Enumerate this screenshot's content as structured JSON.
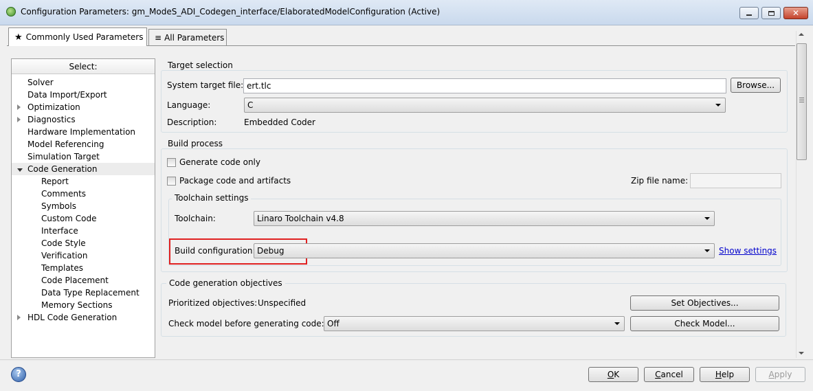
{
  "window": {
    "title": "Configuration Parameters: gm_ModeS_ADI_Codegen_interface/ElaboratedModelConfiguration (Active)",
    "close_glyph": "✕"
  },
  "tabs": [
    {
      "label": "Commonly Used Parameters",
      "icon": "star-icon",
      "glyph": "★"
    },
    {
      "label": "All Parameters",
      "icon": "list-icon",
      "glyph": "≡"
    }
  ],
  "tree": {
    "header": "Select:",
    "items": [
      {
        "label": "Solver",
        "level": 0,
        "expander": "none"
      },
      {
        "label": "Data Import/Export",
        "level": 0,
        "expander": "none"
      },
      {
        "label": "Optimization",
        "level": 0,
        "expander": "collapsed"
      },
      {
        "label": "Diagnostics",
        "level": 0,
        "expander": "collapsed"
      },
      {
        "label": "Hardware Implementation",
        "level": 0,
        "expander": "none"
      },
      {
        "label": "Model Referencing",
        "level": 0,
        "expander": "none"
      },
      {
        "label": "Simulation Target",
        "level": 0,
        "expander": "none"
      },
      {
        "label": "Code Generation",
        "level": 0,
        "expander": "expanded",
        "selected": true
      },
      {
        "label": "Report",
        "level": 1,
        "expander": "none"
      },
      {
        "label": "Comments",
        "level": 1,
        "expander": "none"
      },
      {
        "label": "Symbols",
        "level": 1,
        "expander": "none"
      },
      {
        "label": "Custom Code",
        "level": 1,
        "expander": "none"
      },
      {
        "label": "Interface",
        "level": 1,
        "expander": "none"
      },
      {
        "label": "Code Style",
        "level": 1,
        "expander": "none"
      },
      {
        "label": "Verification",
        "level": 1,
        "expander": "none"
      },
      {
        "label": "Templates",
        "level": 1,
        "expander": "none"
      },
      {
        "label": "Code Placement",
        "level": 1,
        "expander": "none"
      },
      {
        "label": "Data Type Replacement",
        "level": 1,
        "expander": "none"
      },
      {
        "label": "Memory Sections",
        "level": 1,
        "expander": "none"
      },
      {
        "label": "HDL Code Generation",
        "level": 0,
        "expander": "collapsed"
      }
    ]
  },
  "target_selection": {
    "title": "Target selection",
    "system_target_label": "System target file:",
    "system_target_value": "ert.tlc",
    "browse_label": "Browse...",
    "language_label": "Language:",
    "language_value": "C",
    "description_label": "Description:",
    "description_value": "Embedded Coder"
  },
  "build_process": {
    "title": "Build process",
    "generate_code_only": "Generate code only",
    "package_code": "Package code and artifacts",
    "zip_label": "Zip file name:",
    "zip_value": "",
    "toolchain_settings": {
      "title": "Toolchain settings",
      "toolchain_label": "Toolchain:",
      "toolchain_value": "Linaro Toolchain v4.8",
      "build_config_label": "Build configuration:",
      "build_config_value": "Debug",
      "show_settings": "Show settings"
    }
  },
  "objectives": {
    "title": "Code generation objectives",
    "prioritized_label": "Prioritized objectives:",
    "prioritized_value": "Unspecified",
    "set_objectives": "Set Objectives...",
    "check_model_label": "Check model before generating code:",
    "check_model_value": "Off",
    "check_model_button": "Check Model..."
  },
  "footer": {
    "help_glyph": "?",
    "ok": {
      "u": "O",
      "rest": "K"
    },
    "cancel": {
      "u": "C",
      "rest": "ancel"
    },
    "help": {
      "u": "H",
      "rest": "elp"
    },
    "apply": {
      "u": "A",
      "rest": "pply"
    }
  },
  "colors": {
    "highlight": "#e02020",
    "link": "#0000cc"
  }
}
